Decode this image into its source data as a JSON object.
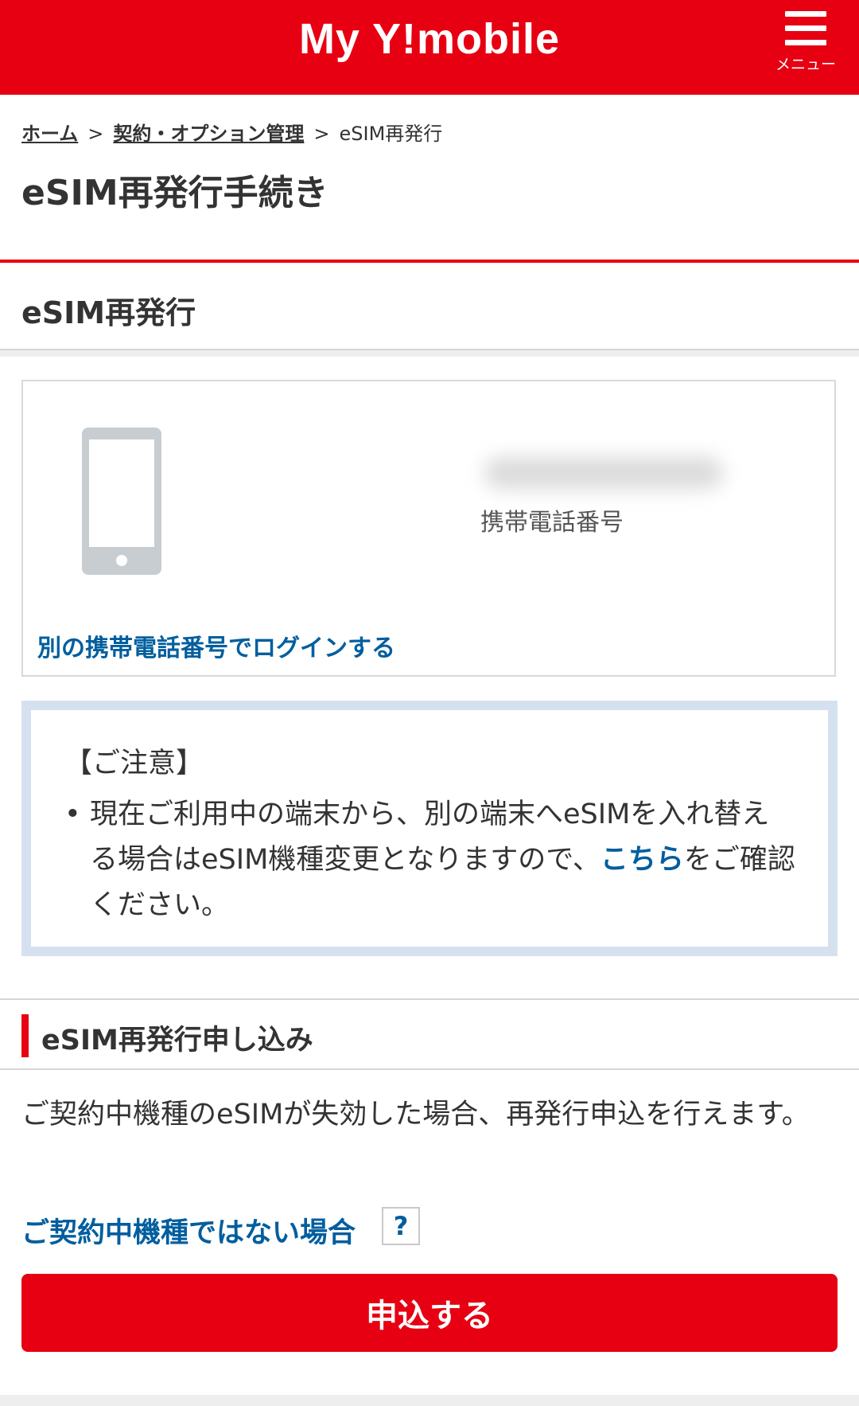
{
  "header": {
    "logo_text": "My Y!mobile",
    "menu_label": "メニュー"
  },
  "breadcrumb": {
    "home": "ホーム",
    "contract": "契約・オプション管理",
    "current": "eSIM再発行",
    "separator": ">"
  },
  "page_title": "eSIM再発行手続き",
  "section_title": "eSIM再発行",
  "phone_card": {
    "phone_number_label": "携帯電話番号",
    "login_link": "別の携帯電話番号でログインする"
  },
  "notice": {
    "title": "【ご注意】",
    "text_before_link": "現在ご利用中の端末から、別の端末へeSIMを入れ替える場合はeSIM機種変更となりますので、",
    "link_text": "こちら",
    "text_after_link": "をご確認ください。"
  },
  "apply": {
    "title": "eSIM再発行申し込み",
    "description": "ご契約中機種のeSIMが失効した場合、再発行申込を行えます。",
    "not_contract_link": "ご契約中機種ではない場合",
    "help_icon": "?",
    "button_label": "申込する"
  },
  "colors": {
    "brand_red": "#e60012",
    "link_blue": "#005e9e",
    "notice_border": "#d6e1f0"
  }
}
